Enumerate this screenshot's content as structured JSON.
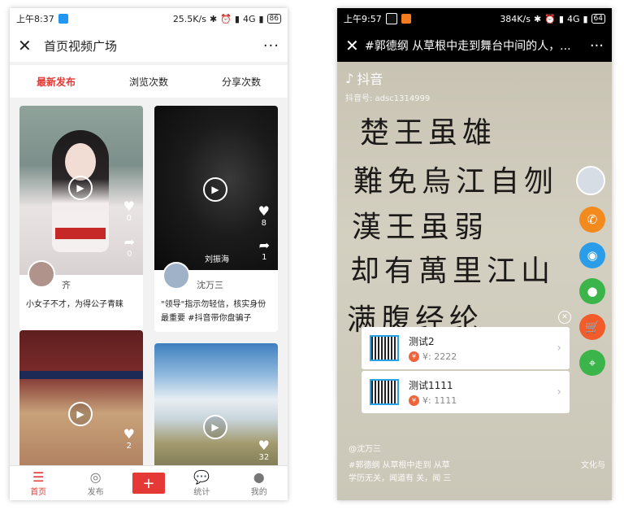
{
  "left_phone": {
    "status": {
      "time": "上午8:37",
      "speed": "25.5K/s",
      "network": "4G",
      "battery": "86"
    },
    "header": {
      "close_icon": "close-icon",
      "title": "首页视频广场",
      "more": "···"
    },
    "tabs": [
      {
        "label": "最新发布",
        "active": true
      },
      {
        "label": "浏览次数",
        "active": false
      },
      {
        "label": "分享次数",
        "active": false
      }
    ],
    "cards": [
      {
        "likes": "0",
        "shares": "0",
        "user": "齐",
        "desc": "小女子不才，为得公子青睐"
      },
      {
        "likes": "8",
        "shares": "1",
        "watermark": "刘振海",
        "user": "沈万三",
        "desc": "\"领导\"指示勿轻信，核实身份最重要 #抖音带你盘骗子"
      },
      {
        "likes": "2"
      },
      {
        "likes": "32"
      }
    ],
    "nav": [
      {
        "label": "首页",
        "icon": "menu-icon",
        "active": true
      },
      {
        "label": "发布",
        "icon": "compass-icon",
        "active": false
      },
      {
        "label": "+",
        "icon": "add-icon"
      },
      {
        "label": "统计",
        "icon": "chat-icon",
        "active": false
      },
      {
        "label": "我的",
        "icon": "user-icon",
        "active": false
      }
    ]
  },
  "right_phone": {
    "status": {
      "time": "上午9:57",
      "speed": "384K/s",
      "network": "4G",
      "battery": "64"
    },
    "header": {
      "title": "#郭德纲 从草根中走到舞台中间的人，...",
      "more": "···"
    },
    "tiktok": {
      "logo": "抖音",
      "id": "抖音号: adsc1314999"
    },
    "calligraphy": [
      "楚王虽雄",
      "難免烏江自刎",
      "漢王虽弱",
      "却有萬里江山",
      "满腹经纶"
    ],
    "goods": [
      {
        "name": "测试2",
        "price": "¥: 2222"
      },
      {
        "name": "测试1111",
        "price": "¥: 1111"
      }
    ],
    "caption": {
      "user": "@沈万三",
      "line1": "#郭德纲 从草根中走到 从草",
      "line2": "学历无关，闻道有 关，闻 三",
      "side_text": "文化与"
    },
    "colors": {
      "phone": "#f28a1e",
      "qq": "#2b9de8",
      "wechat": "#3bb54a",
      "cart": "#f25c2b",
      "location": "#3bb54a"
    }
  }
}
